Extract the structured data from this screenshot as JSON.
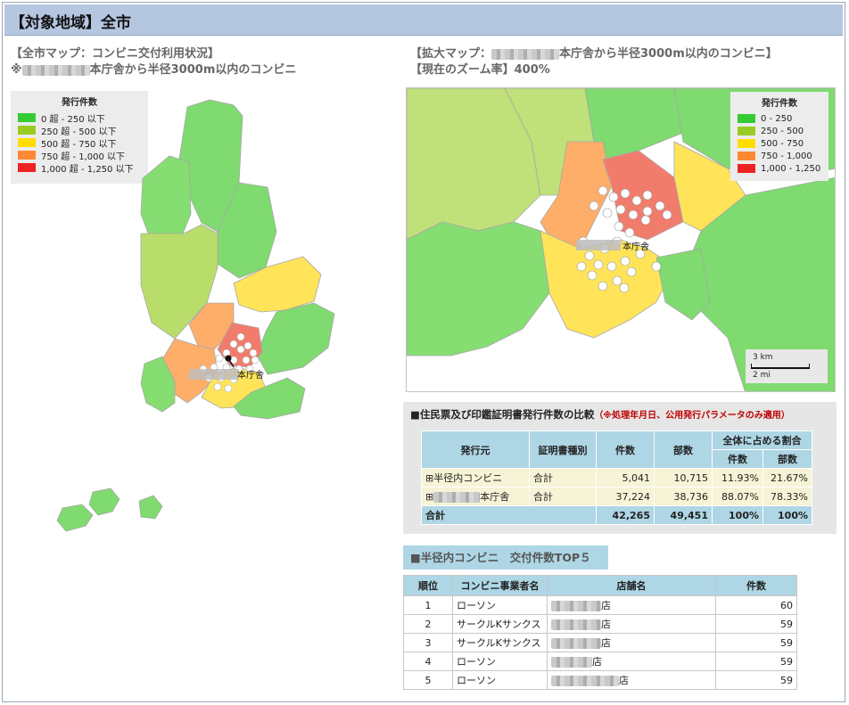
{
  "header": {
    "title": "【対象地域】全市"
  },
  "left_map": {
    "title_line1": "【全市マップ：コンビニ交付利用状況】",
    "title_line2_prefix": "※",
    "title_line2_suffix": "本庁舎から半径3000m以内のコンビニ",
    "marker_label": "本庁舎",
    "legend": {
      "title": "発行件数",
      "items": [
        {
          "label": "0 超 - 250 以下",
          "color": "#33cc33"
        },
        {
          "label": "250 超 - 500 以下",
          "color": "#99cc22"
        },
        {
          "label": "500 超 - 750 以下",
          "color": "#ffdd00"
        },
        {
          "label": "750 超 - 1,000 以下",
          "color": "#ff8833"
        },
        {
          "label": "1,000 超 - 1,250 以下",
          "color": "#ee2222"
        }
      ]
    }
  },
  "zoom_map": {
    "title_line1_prefix": "【拡大マップ：",
    "title_line1_suffix": "本庁舎から半径3000m以内のコンビニ】",
    "title_line2": "【現在のズーム率】400%",
    "marker_label": "本庁舎",
    "legend": {
      "title": "発行件数",
      "items": [
        {
          "label": "0 - 250",
          "color": "#33cc33"
        },
        {
          "label": "250 - 500",
          "color": "#99cc22"
        },
        {
          "label": "500 - 750",
          "color": "#ffdd00"
        },
        {
          "label": "750 - 1,000",
          "color": "#ff8833"
        },
        {
          "label": "1,000 - 1,250",
          "color": "#ee2222"
        }
      ]
    },
    "scale": {
      "km": "3 km",
      "mi": "2 mi"
    }
  },
  "comparison": {
    "title": "■住民票及び印鑑証明書発行件数の比較",
    "note": "（※処理年月日、公用発行パラメータのみ適用）",
    "headers": {
      "issuer": "発行元",
      "cert_type": "証明書種別",
      "count": "件数",
      "copies": "部数",
      "share": "全体に占める割合",
      "share_count": "件数",
      "share_copies": "部数"
    },
    "rows": [
      {
        "issuer_prefix": "⊞",
        "issuer": "半径内コンビニ",
        "cert_type": "合計",
        "count": "5,041",
        "copies": "10,715",
        "share_count": "11.93%",
        "share_copies": "21.67%"
      },
      {
        "issuer_prefix": "⊞",
        "issuer": "本庁舎",
        "cert_type": "合計",
        "count": "37,224",
        "copies": "38,736",
        "share_count": "88.07%",
        "share_copies": "78.33%"
      }
    ],
    "total": {
      "label": "合計",
      "count": "42,265",
      "copies": "49,451",
      "share_count": "100%",
      "share_copies": "100%"
    }
  },
  "top5": {
    "title": "■半径内コンビニ　交付件数TOP５",
    "headers": {
      "rank": "順位",
      "operator": "コンビニ事業者名",
      "store": "店舗名",
      "count": "件数"
    },
    "rows": [
      {
        "rank": "1",
        "operator": "ローソン",
        "store_suffix": "店",
        "count": "60"
      },
      {
        "rank": "2",
        "operator": "サークルKサンクス",
        "store_suffix": "店",
        "count": "59"
      },
      {
        "rank": "3",
        "operator": "サークルKサンクス",
        "store_suffix": "店",
        "count": "59"
      },
      {
        "rank": "4",
        "operator": "ローソン",
        "store_suffix": "店",
        "count": "59"
      },
      {
        "rank": "5",
        "operator": "ローソン",
        "store_suffix": "店",
        "count": "59"
      }
    ]
  }
}
